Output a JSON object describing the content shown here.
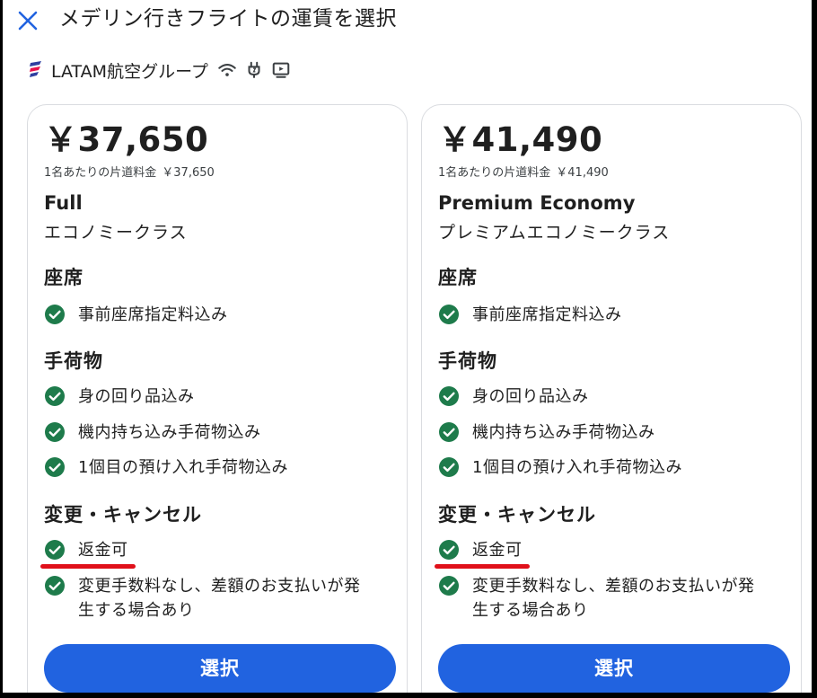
{
  "header": {
    "title": "メデリン行きフライトの運賃を選択"
  },
  "airline": {
    "name": "LATAM航空グループ",
    "amenities": [
      "wifi-icon",
      "power-plug-icon",
      "video-screen-icon"
    ]
  },
  "colors": {
    "accent": "#2163e0",
    "check": "#1e7b4b",
    "highlight": "#e0101a"
  },
  "fares": [
    {
      "price": "￥37,650",
      "per_person_label": "1名あたりの片道料金",
      "per_person_value": "￥37,650",
      "fare_name": "Full",
      "cabin": "エコノミークラス",
      "seat_title": "座席",
      "seat_items": [
        "事前座席指定料込み"
      ],
      "baggage_title": "手荷物",
      "baggage_items": [
        "身の回り品込み",
        "機内持ち込み手荷物込み",
        "1個目の預け入れ手荷物込み"
      ],
      "change_title": "変更・キャンセル",
      "change_items": [
        "返金可",
        "変更手数料なし、差額のお支払いが発生する場合あり"
      ],
      "select_label": "選択"
    },
    {
      "price": "￥41,490",
      "per_person_label": "1名あたりの片道料金",
      "per_person_value": "￥41,490",
      "fare_name": "Premium Economy",
      "cabin": "プレミアムエコノミークラス",
      "seat_title": "座席",
      "seat_items": [
        "事前座席指定料込み"
      ],
      "baggage_title": "手荷物",
      "baggage_items": [
        "身の回り品込み",
        "機内持ち込み手荷物込み",
        "1個目の預け入れ手荷物込み"
      ],
      "change_title": "変更・キャンセル",
      "change_items": [
        "返金可",
        "変更手数料なし、差額のお支払いが発生する場合あり"
      ],
      "select_label": "選択"
    }
  ]
}
